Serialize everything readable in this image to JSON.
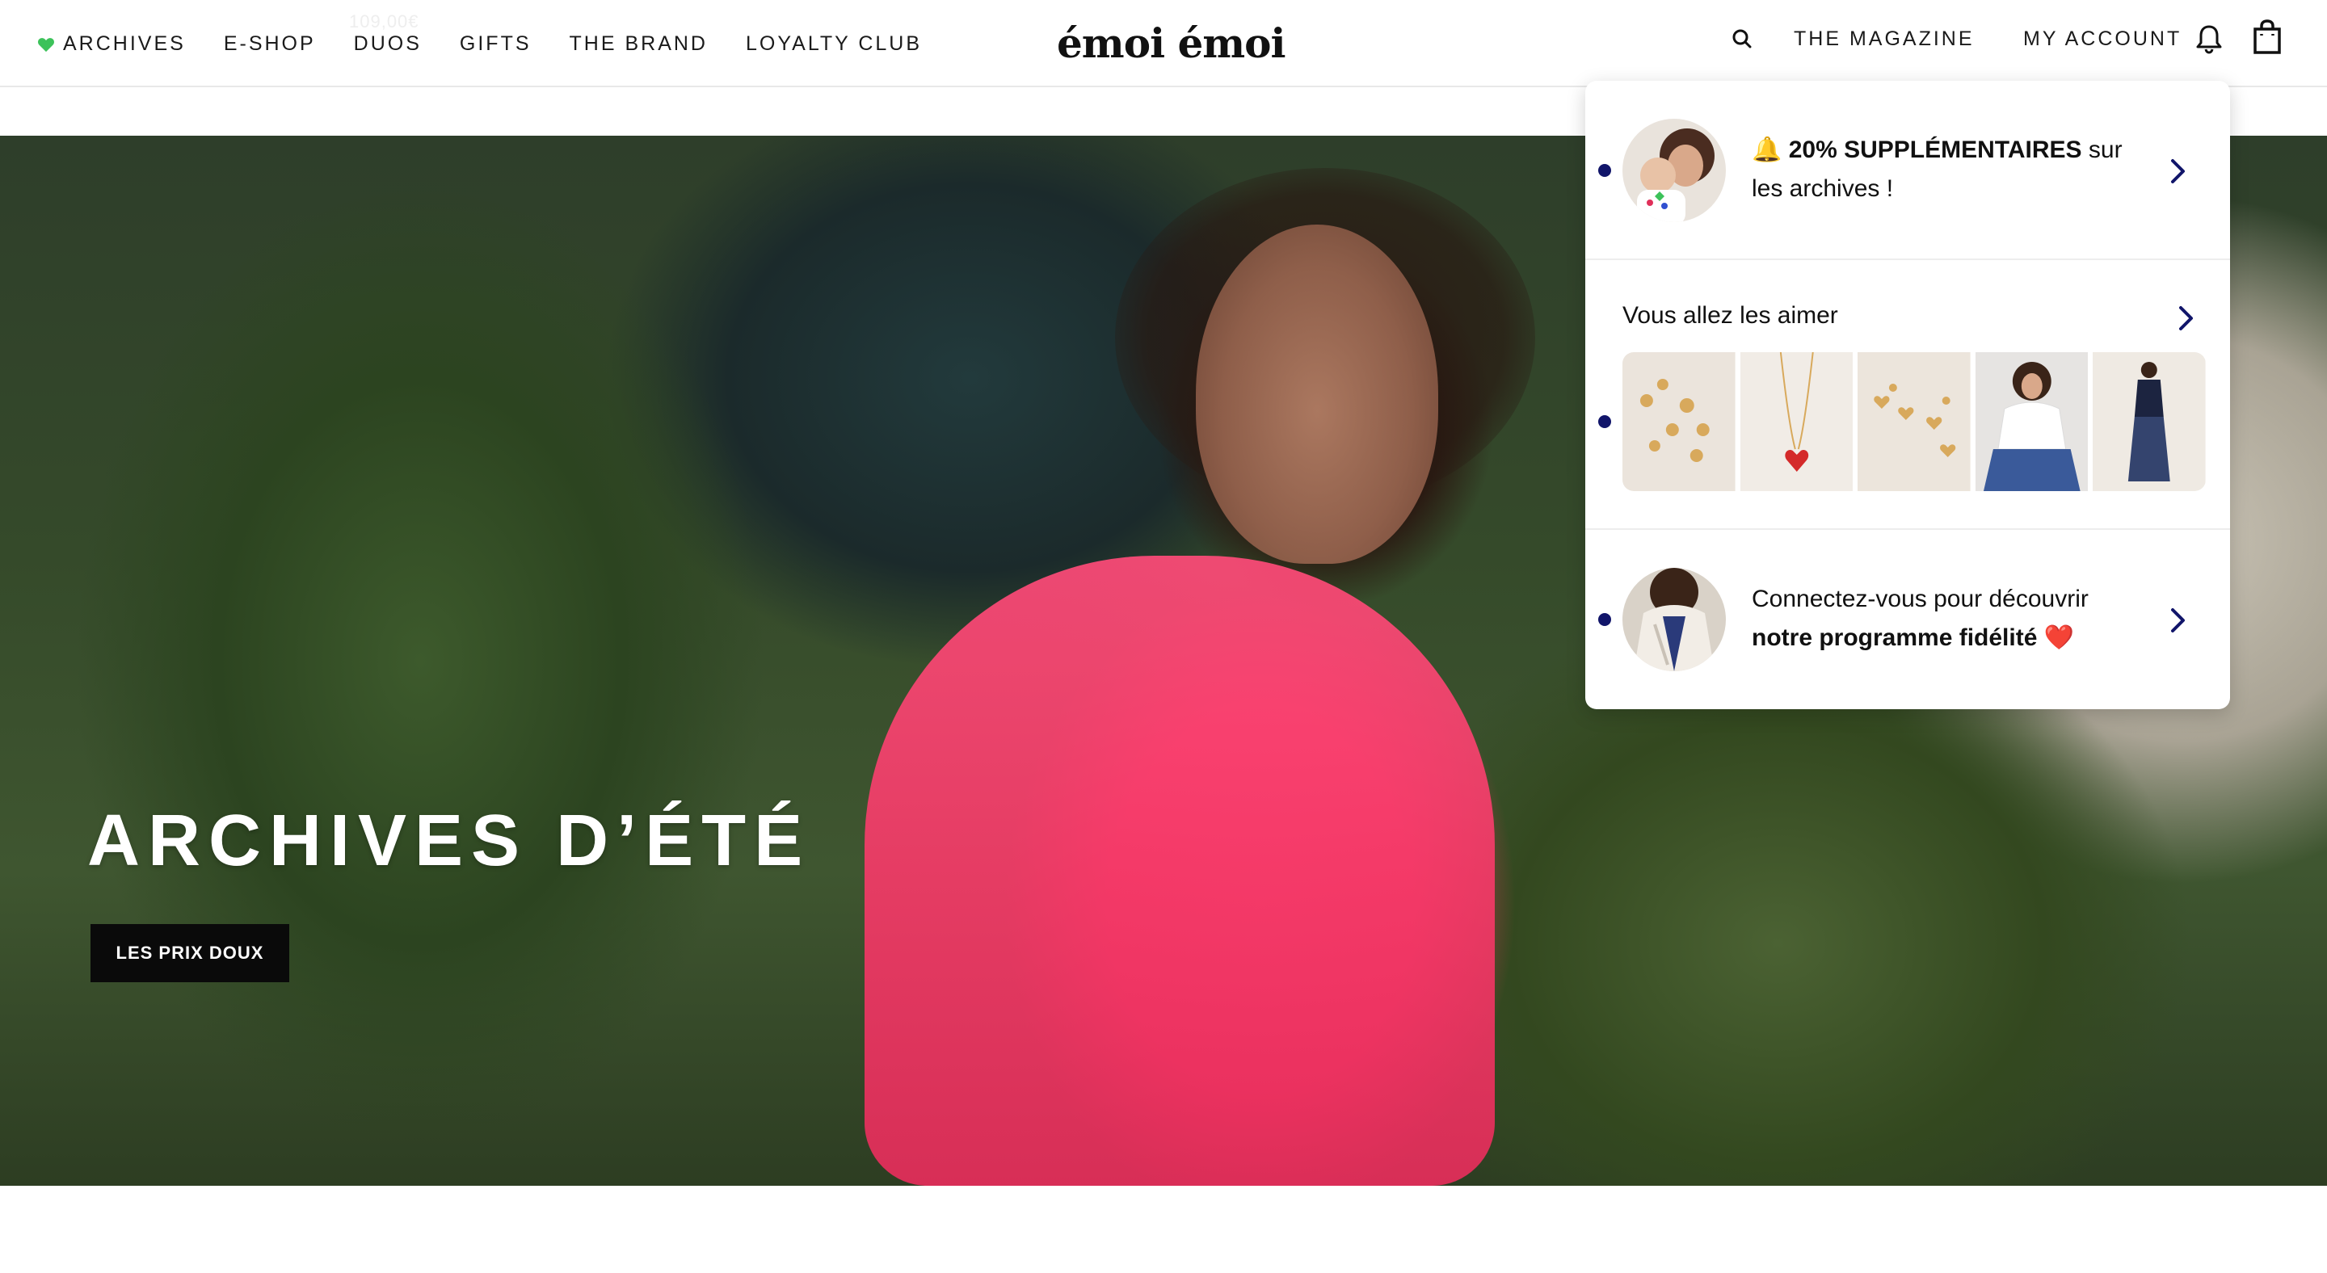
{
  "header": {
    "nav_left": [
      {
        "label": "ARCHIVES",
        "icon": "green-heart-icon"
      },
      {
        "label": "E-SHOP"
      },
      {
        "label": "DUOS"
      },
      {
        "label": "GIFTS"
      },
      {
        "label": "THE BRAND"
      },
      {
        "label": "LOYALTY CLUB"
      }
    ],
    "ghost_price": "109,00€",
    "logo": "émoi émoi",
    "nav_right": {
      "search_icon": "search-icon",
      "magazine": "THE MAGAZINE",
      "account": "MY ACCOUNT",
      "bell_icon": "bell-icon",
      "bag_icon": "shopping-bag-icon"
    }
  },
  "hero": {
    "title": "ARCHIVES D’ÉTÉ",
    "button": "LES PRIX DOUX"
  },
  "notifications": {
    "items": [
      {
        "icon": "🔔",
        "bold": "20% SUPPLÉMENTAIRES",
        "text": " sur les archives !",
        "unread": true
      },
      {
        "title": "Vous allez les aimer",
        "unread": true,
        "thumbnails": [
          "earrings-product",
          "heart-necklace-product",
          "heart-earrings-product",
          "white-tshirt-model",
          "dark-outfit-model"
        ]
      },
      {
        "text": "Connectez-vous pour découvrir ",
        "bold": "notre programme fidélité",
        "emoji": "❤️",
        "unread": true
      }
    ]
  },
  "colors": {
    "unread_dot": "#11156a",
    "accent_heart": "#3cc25a",
    "hero_dress": "#f43a68",
    "hero_button_bg": "#0a0a0a"
  }
}
